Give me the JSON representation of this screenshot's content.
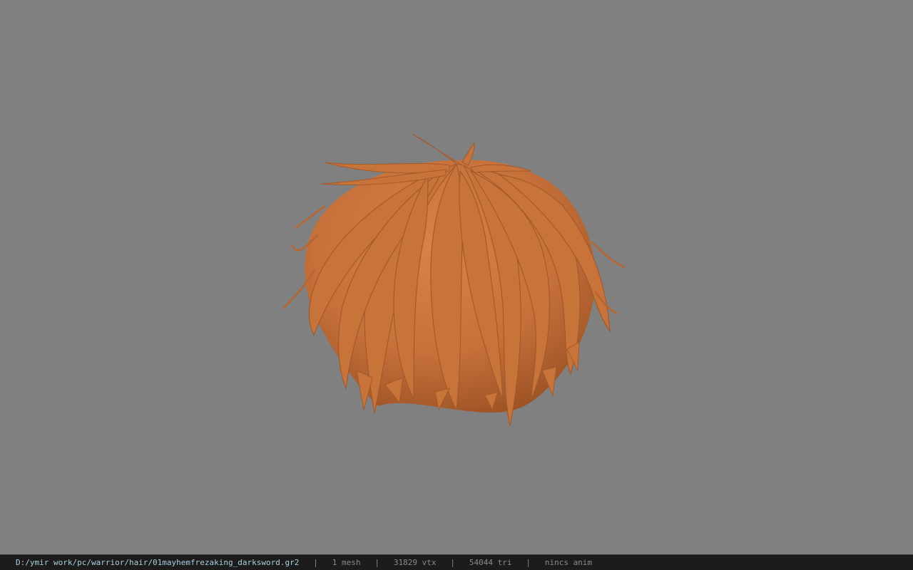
{
  "viewport": {
    "background_color": "#808080",
    "model": {
      "name": "hair-mesh",
      "color": "#c8733a"
    }
  },
  "statusbar": {
    "file_path": "D:/ymir work/pc/warrior/hair/01mayhemfrezaking_darksword.gr2",
    "separator": "|",
    "mesh_count": "1 mesh",
    "vertex_count": "31829 vtx",
    "triangle_count": "54044 tri",
    "anim_status": "nincs anim"
  }
}
